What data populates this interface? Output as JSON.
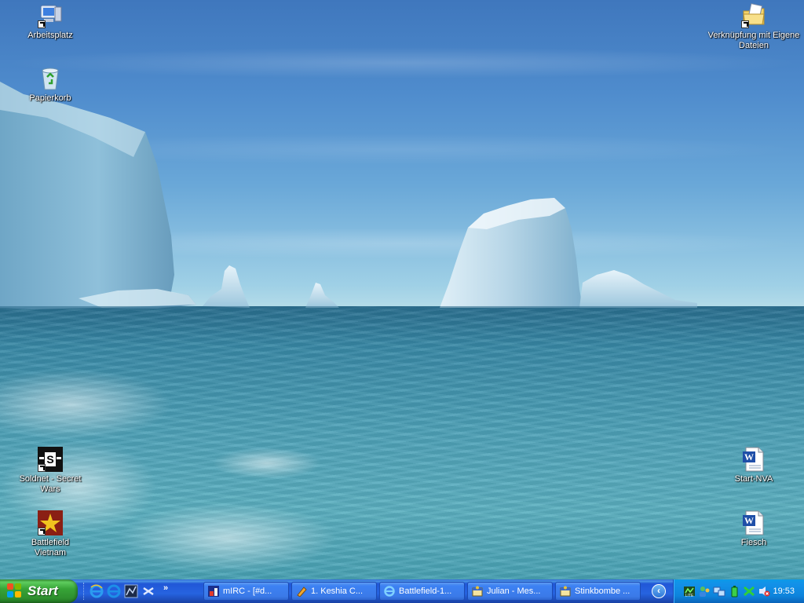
{
  "desktop": {
    "icons_left": [
      {
        "label": "Arbeitsplatz",
        "icon": "my-computer-icon"
      },
      {
        "label": "Papierkorb",
        "icon": "recycle-bin-icon"
      },
      {
        "label": "Soldnet - Secret Wars",
        "icon": "soldnet-game-icon"
      },
      {
        "label": "Battlefield Vietnam",
        "icon": "battlefield-vietnam-icon"
      }
    ],
    "icons_right": [
      {
        "label": "Verknüpfung mit Eigene Dateien",
        "icon": "my-documents-folder-icon"
      },
      {
        "label": "Start-NVA",
        "icon": "word-document-icon"
      },
      {
        "label": "Fiesch",
        "icon": "word-document-icon"
      }
    ]
  },
  "taskbar": {
    "start_label": "Start",
    "quicklaunch": [
      "internet-explorer-icon",
      "internet-explorer-icon",
      "media-icon",
      "network-icon"
    ],
    "overflow": "»",
    "tasks": [
      {
        "label": "mIRC - [#d...",
        "icon": "mirc-icon"
      },
      {
        "label": "1. Keshia C...",
        "icon": "winamp-icon"
      },
      {
        "label": "Battlefield-1...",
        "icon": "internet-explorer-icon"
      },
      {
        "label": "Julian - Mes...",
        "icon": "messenger-window-icon"
      },
      {
        "label": "Stinkbombe ...",
        "icon": "messenger-window-icon"
      }
    ],
    "tray_expand": "‹",
    "tray_icons": [
      "lite-app-icon",
      "user-icon",
      "network-connection-icon",
      "battery-icon",
      "x-app-icon",
      "volume-muted-icon"
    ],
    "clock": "19:53"
  },
  "colors": {
    "taskbar_blue": "#2663e0",
    "start_green": "#37a437",
    "tray_blue": "#0d84dc"
  }
}
